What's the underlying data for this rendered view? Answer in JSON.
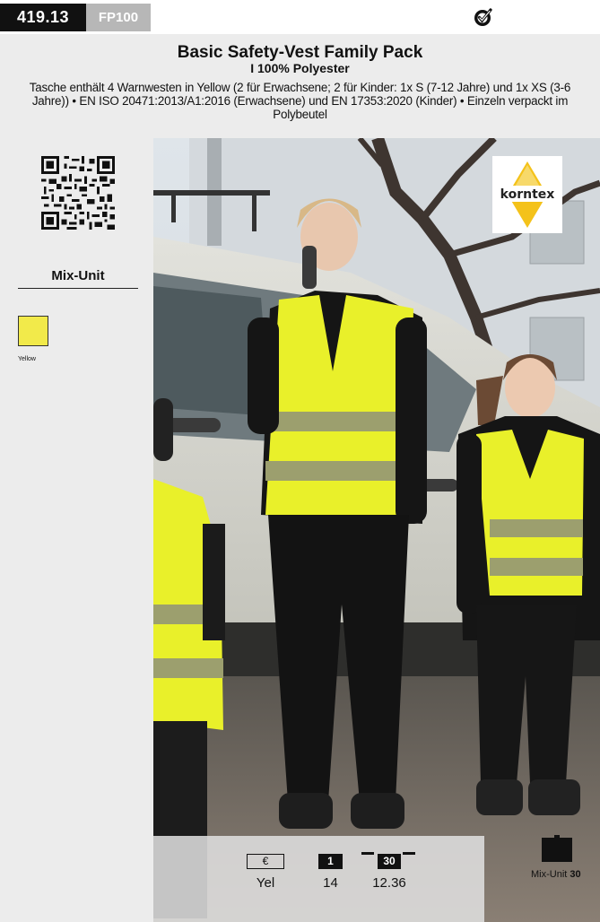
{
  "header": {
    "article_code": "419.13",
    "model_code": "FP100",
    "badge_icon": "checkmark-badge-icon"
  },
  "product": {
    "title": "Basic Safety-Vest Family Pack",
    "subtitle": "I 100% Polyester",
    "description": "Tasche enthält 4 Warnwesten in Yellow (2 für Erwachsene; 2 für Kinder: 1x S (7-12 Jahre) und 1x XS (3-6 Jahre)) • EN ISO 20471:2013/A1:2016 (Erwachsene) und EN 17353:2020 (Kinder) • Einzeln verpackt im Polybeutel"
  },
  "sidebar": {
    "qr_icon": "qr-code-icon",
    "mix_heading": "Mix-Unit",
    "swatches": [
      {
        "label": "Yellow",
        "color": "#f2ea4a"
      }
    ]
  },
  "brand": {
    "logo_text": "korntex"
  },
  "pricing": {
    "currency_symbol": "€",
    "qty_header": "1",
    "pack_header": "30",
    "row": {
      "color": "Yel",
      "unit_price": "14",
      "pack_price": "12.36"
    }
  },
  "footer": {
    "box_icon": "carton-box-icon",
    "mix_label": "Mix-Unit",
    "mix_value": "30"
  },
  "colors": {
    "vest_yellow": "#e9f02a",
    "sidebar_bg": "#ececec"
  }
}
